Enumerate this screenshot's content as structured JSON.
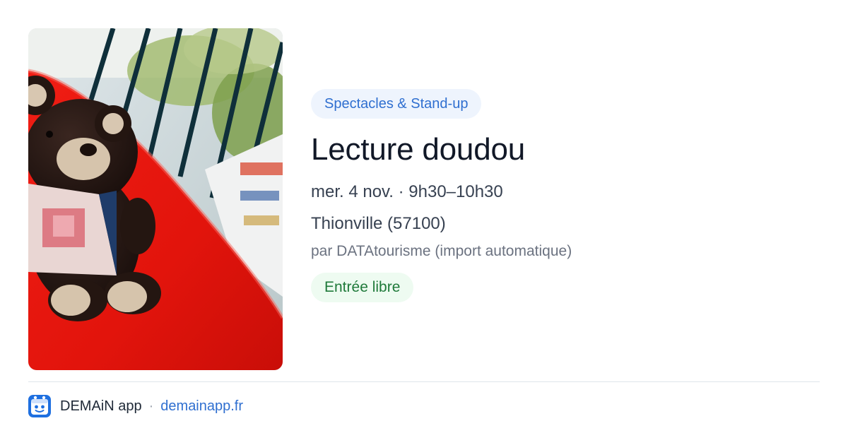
{
  "event": {
    "image_alt": "Lecture doudou",
    "category": "Spectacles & Stand-up",
    "title": "Lecture doudou",
    "date": "mer. 4 nov. · 9h30–10h30",
    "location": "Thionville (57100)",
    "organizer": "par DATAtourisme (import automatique)",
    "price": "Entrée libre"
  },
  "footer": {
    "app_name": "DEMAiN app",
    "separator": "·",
    "link": "demainapp.fr"
  },
  "colors": {
    "category_bg": "#eef4fd",
    "category_text": "#2f6fd0",
    "price_bg": "#eefbf1",
    "price_text": "#1f7a3a",
    "link": "#2f6fd0",
    "title": "#111827"
  },
  "icons": {
    "app_logo": "demain-logo-icon"
  }
}
